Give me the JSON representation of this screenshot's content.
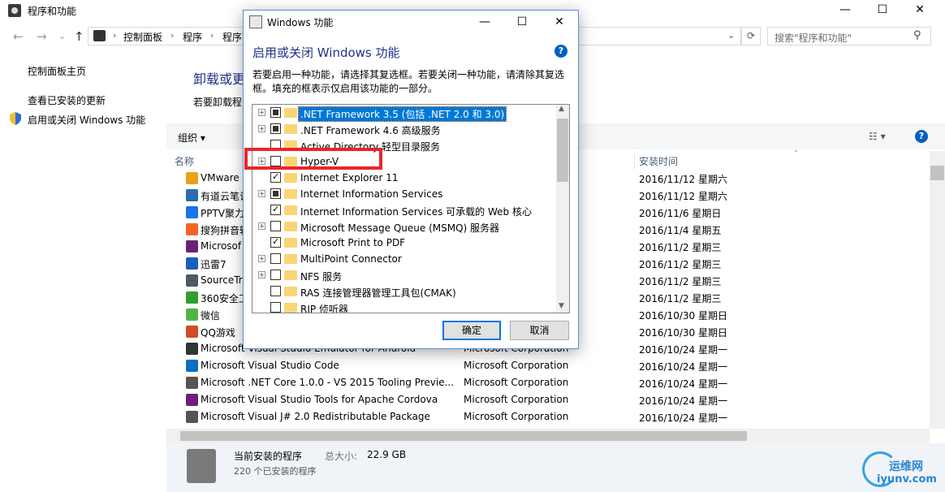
{
  "window": {
    "title": "程序和功能",
    "minimize": "—",
    "maximize": "☐",
    "close": "✕"
  },
  "address": {
    "crumbs": [
      "控制面板",
      "程序",
      "程序"
    ],
    "separator": "›",
    "refresh": "⟳",
    "search_placeholder": "搜索\"程序和功能\""
  },
  "nav": {
    "back": "←",
    "forward": "→",
    "up": "↑",
    "dropdown": "⌄"
  },
  "sidebar": {
    "items": [
      {
        "label": "控制面板主页"
      },
      {
        "label": "查看已安装的更新"
      },
      {
        "label": "启用或关闭 Windows 功能"
      }
    ]
  },
  "main": {
    "heading": "卸载或更",
    "subheading": "若要卸载程",
    "toolbar": {
      "organize": "组织 ▾",
      "view": "☷ ▾",
      "help": "?"
    },
    "columns": {
      "name": "名称",
      "installed": "安装时间"
    },
    "rows": [
      {
        "name": "VMware",
        "publisher": "",
        "date": "2016/11/12 星期六",
        "color": "#e8a317"
      },
      {
        "name": "有道云笔记",
        "publisher": "",
        "date": "2016/11/12 星期六",
        "color": "#2b6cb0"
      },
      {
        "name": "PPTV聚力",
        "publisher": "",
        "date": "2016/11/6 星期日",
        "color": "#1a73e8"
      },
      {
        "name": "搜狗拼音输",
        "publisher": "",
        "date": "2016/11/4 星期五",
        "color": "#f26522"
      },
      {
        "name": "Microsof",
        "publisher": "",
        "date": "2016/11/2 星期三",
        "color": "#68217a"
      },
      {
        "name": "迅雷7",
        "publisher": "",
        "date": "2016/11/2 星期三",
        "color": "#1b5fbd"
      },
      {
        "name": "SourceTr",
        "publisher": "",
        "date": "2016/11/2 星期三",
        "color": "#4a5a6a"
      },
      {
        "name": "360安全工",
        "publisher": "",
        "date": "2016/11/2 星期三",
        "color": "#2e9f2e"
      },
      {
        "name": "微信",
        "publisher": "",
        "date": "2016/10/30 星期日",
        "color": "#51b546"
      },
      {
        "name": "QQ游戏",
        "publisher": "",
        "date": "2016/10/30 星期日",
        "color": "#d24b2a"
      },
      {
        "name": "Microsoft Visual Studio Emulator for Android",
        "publisher": "Microsoft Corporation",
        "date": "2016/10/24 星期一",
        "color": "#333333"
      },
      {
        "name": "Microsoft Visual Studio Code",
        "publisher": "Microsoft Corporation",
        "date": "2016/10/24 星期一",
        "color": "#0a6fc2"
      },
      {
        "name": "Microsoft .NET Core 1.0.0 - VS 2015 Tooling Previe...",
        "publisher": "Microsoft Corporation",
        "date": "2016/10/24 星期一",
        "color": "#555555"
      },
      {
        "name": "Microsoft Visual Studio Tools for Apache Cordova",
        "publisher": "Microsoft Corporation",
        "date": "2016/10/24 星期一",
        "color": "#68217a"
      },
      {
        "name": "Microsoft Visual J# 2.0 Redistributable Package",
        "publisher": "Microsoft Corporation",
        "date": "2016/10/24 星期一",
        "color": "#555555"
      }
    ]
  },
  "status": {
    "title": "当前安装的程序",
    "size_label": "总大小:",
    "size": "22.9 GB",
    "count": "220 个已安装的程序"
  },
  "watermark": {
    "text": "运维网",
    "url": "iyunv.com"
  },
  "dialog": {
    "title": "Windows 功能",
    "heading": "启用或关闭 Windows 功能",
    "description": "若要启用一种功能，请选择其复选框。若要关闭一种功能，请清除其复选框。填充的框表示仅启用该功能的一部分。",
    "help": "?",
    "features": [
      {
        "label": ".NET Framework 3.5 (包括 .NET 2.0 和 3.0)",
        "state": "partial",
        "expandable": true,
        "selected": true
      },
      {
        "label": ".NET Framework 4.6 高级服务",
        "state": "partial",
        "expandable": true,
        "selected": false
      },
      {
        "label": "Active Directory 轻型目录服务",
        "state": "none",
        "expandable": false,
        "selected": false
      },
      {
        "label": "Hyper-V",
        "state": "none",
        "expandable": true,
        "selected": false
      },
      {
        "label": "Internet Explorer 11",
        "state": "checked",
        "expandable": false,
        "selected": false
      },
      {
        "label": "Internet Information Services",
        "state": "partial",
        "expandable": true,
        "selected": false
      },
      {
        "label": "Internet Information Services 可承载的 Web 核心",
        "state": "checked",
        "expandable": false,
        "selected": false
      },
      {
        "label": "Microsoft Message Queue (MSMQ) 服务器",
        "state": "none",
        "expandable": true,
        "selected": false
      },
      {
        "label": "Microsoft Print to PDF",
        "state": "checked",
        "expandable": false,
        "selected": false
      },
      {
        "label": "MultiPoint Connector",
        "state": "none",
        "expandable": true,
        "selected": false
      },
      {
        "label": "NFS 服务",
        "state": "none",
        "expandable": true,
        "selected": false
      },
      {
        "label": "RAS 连接管理器管理工具包(CMAK)",
        "state": "none",
        "expandable": false,
        "selected": false
      },
      {
        "label": "RIP 侦听器",
        "state": "none",
        "expandable": false,
        "selected": false
      }
    ],
    "ok": "确定",
    "cancel": "取消",
    "highlight_color": "#e8262a"
  }
}
